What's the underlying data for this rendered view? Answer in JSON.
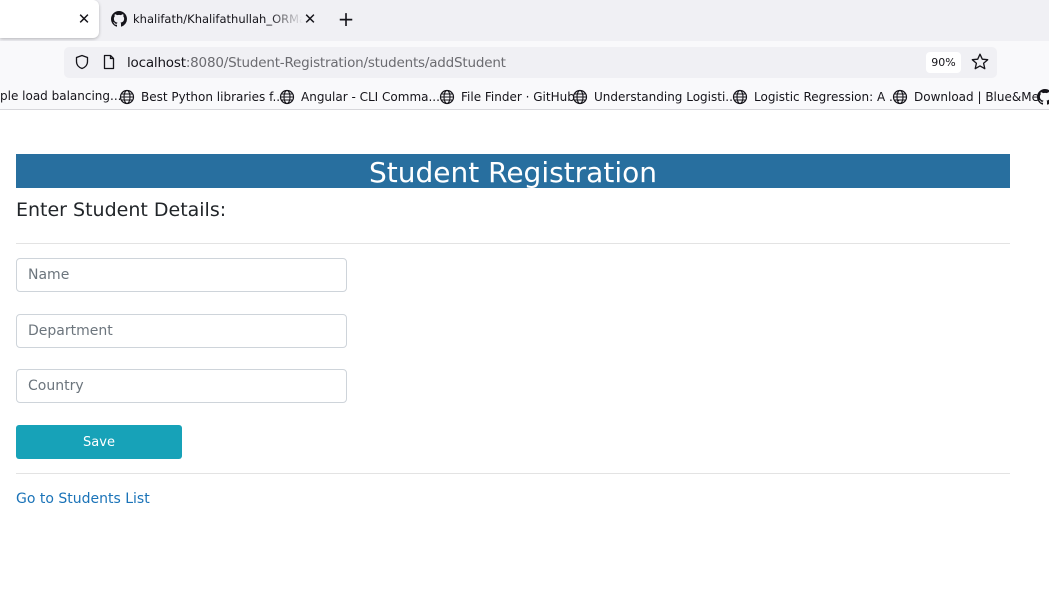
{
  "browser": {
    "tabs": [
      {
        "title": "",
        "active": true
      },
      {
        "title": "khalifath/Khalifathullah_ORMapping",
        "active": false
      }
    ],
    "address": {
      "host": "localhost",
      "rest": ":8080/Student-Registration/students/addStudent"
    },
    "zoom": "90%",
    "bookmarks": [
      {
        "label": "ple load balancing..."
      },
      {
        "label": "Best Python libraries f..."
      },
      {
        "label": "Angular - CLI Comma..."
      },
      {
        "label": "File Finder · GitHub"
      },
      {
        "label": "Understanding Logisti..."
      },
      {
        "label": "Logistic Regression: A ..."
      },
      {
        "label": "Download | Blue&Me"
      }
    ]
  },
  "page": {
    "header": "Student Registration",
    "subheading": "Enter Student Details:",
    "fields": {
      "name": {
        "placeholder": "Name",
        "value": ""
      },
      "department": {
        "placeholder": "Department",
        "value": ""
      },
      "country": {
        "placeholder": "Country",
        "value": ""
      }
    },
    "save_label": "Save",
    "list_link": "Go to Students List"
  },
  "colors": {
    "header_bg": "#286f9f",
    "save_bg": "#17a2b8",
    "link": "#1a73b8"
  }
}
